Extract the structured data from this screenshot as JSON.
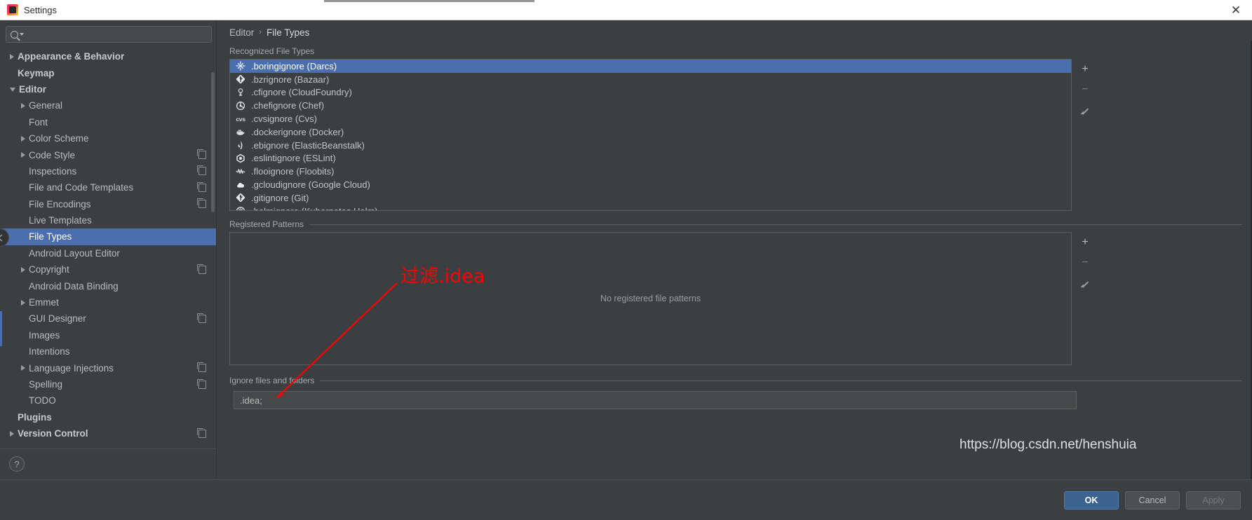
{
  "window": {
    "title": "Settings",
    "app_icon": "intellij-idea-icon",
    "close_label": "✕"
  },
  "search": {
    "placeholder": "",
    "value": "",
    "icon": "search-icon",
    "caret_icon": "chevron-down-icon"
  },
  "sidebar": {
    "items": [
      {
        "label": "Appearance & Behavior",
        "indent": 0,
        "arrow": "right",
        "bold": true,
        "selected": false,
        "copy": false
      },
      {
        "label": "Keymap",
        "indent": 0,
        "arrow": "none",
        "bold": true,
        "selected": false,
        "copy": false
      },
      {
        "label": "Editor",
        "indent": 0,
        "arrow": "down",
        "bold": true,
        "selected": false,
        "copy": false
      },
      {
        "label": "General",
        "indent": 1,
        "arrow": "right",
        "bold": false,
        "selected": false,
        "copy": false
      },
      {
        "label": "Font",
        "indent": 1,
        "arrow": "none",
        "bold": false,
        "selected": false,
        "copy": false
      },
      {
        "label": "Color Scheme",
        "indent": 1,
        "arrow": "right",
        "bold": false,
        "selected": false,
        "copy": false
      },
      {
        "label": "Code Style",
        "indent": 1,
        "arrow": "right",
        "bold": false,
        "selected": false,
        "copy": true
      },
      {
        "label": "Inspections",
        "indent": 1,
        "arrow": "none",
        "bold": false,
        "selected": false,
        "copy": true
      },
      {
        "label": "File and Code Templates",
        "indent": 1,
        "arrow": "none",
        "bold": false,
        "selected": false,
        "copy": true
      },
      {
        "label": "File Encodings",
        "indent": 1,
        "arrow": "none",
        "bold": false,
        "selected": false,
        "copy": true
      },
      {
        "label": "Live Templates",
        "indent": 1,
        "arrow": "none",
        "bold": false,
        "selected": false,
        "copy": false
      },
      {
        "label": "File Types",
        "indent": 1,
        "arrow": "none",
        "bold": false,
        "selected": true,
        "copy": false
      },
      {
        "label": "Android Layout Editor",
        "indent": 1,
        "arrow": "none",
        "bold": false,
        "selected": false,
        "copy": false
      },
      {
        "label": "Copyright",
        "indent": 1,
        "arrow": "right",
        "bold": false,
        "selected": false,
        "copy": true
      },
      {
        "label": "Android Data Binding",
        "indent": 1,
        "arrow": "none",
        "bold": false,
        "selected": false,
        "copy": false
      },
      {
        "label": "Emmet",
        "indent": 1,
        "arrow": "right",
        "bold": false,
        "selected": false,
        "copy": false
      },
      {
        "label": "GUI Designer",
        "indent": 1,
        "arrow": "none",
        "bold": false,
        "selected": false,
        "copy": true
      },
      {
        "label": "Images",
        "indent": 1,
        "arrow": "none",
        "bold": false,
        "selected": false,
        "copy": false
      },
      {
        "label": "Intentions",
        "indent": 1,
        "arrow": "none",
        "bold": false,
        "selected": false,
        "copy": false
      },
      {
        "label": "Language Injections",
        "indent": 1,
        "arrow": "right",
        "bold": false,
        "selected": false,
        "copy": true
      },
      {
        "label": "Spelling",
        "indent": 1,
        "arrow": "none",
        "bold": false,
        "selected": false,
        "copy": true
      },
      {
        "label": "TODO",
        "indent": 1,
        "arrow": "none",
        "bold": false,
        "selected": false,
        "copy": false
      },
      {
        "label": "Plugins",
        "indent": 0,
        "arrow": "none",
        "bold": true,
        "selected": false,
        "copy": false
      },
      {
        "label": "Version Control",
        "indent": 0,
        "arrow": "right",
        "bold": true,
        "selected": false,
        "copy": true
      }
    ],
    "help_label": "?",
    "collapse_icon": "chevron-left-icon"
  },
  "breadcrumb": {
    "parent": "Editor",
    "separator": "›",
    "current": "File Types"
  },
  "recognized": {
    "label": "Recognized File Types",
    "rows": [
      {
        "name": ".boringignore (Darcs)",
        "icon": "darcs-icon",
        "selected": true
      },
      {
        "name": ".bzrignore (Bazaar)",
        "icon": "bazaar-icon",
        "selected": false
      },
      {
        "name": ".cfignore (CloudFoundry)",
        "icon": "cloudfoundry-icon",
        "selected": false
      },
      {
        "name": ".chefignore (Chef)",
        "icon": "chef-icon",
        "selected": false
      },
      {
        "name": ".cvsignore (Cvs)",
        "icon": "cvs-icon",
        "selected": false
      },
      {
        "name": ".dockerignore (Docker)",
        "icon": "docker-icon",
        "selected": false
      },
      {
        "name": ".ebignore (ElasticBeanstalk)",
        "icon": "elasticbeanstalk-icon",
        "selected": false
      },
      {
        "name": ".eslintignore (ESLint)",
        "icon": "eslint-icon",
        "selected": false
      },
      {
        "name": ".flooignore (Floobits)",
        "icon": "floobits-icon",
        "selected": false
      },
      {
        "name": ".gcloudignore (Google Cloud)",
        "icon": "google-cloud-icon",
        "selected": false
      },
      {
        "name": ".gitignore (Git)",
        "icon": "git-icon",
        "selected": false
      },
      {
        "name": ".helmignore (Kubernetes Helm)",
        "icon": "helm-icon",
        "selected": false
      }
    ],
    "toolbar": {
      "add_label": "+",
      "remove_label": "−",
      "edit_icon": "pencil-icon"
    }
  },
  "registered": {
    "label": "Registered Patterns",
    "empty_text": "No registered file patterns",
    "toolbar": {
      "add_label": "+",
      "remove_label": "−",
      "edit_icon": "pencil-icon"
    }
  },
  "ignore": {
    "label": "Ignore files and folders",
    "value": ".idea;",
    "placeholder": ""
  },
  "footer": {
    "ok": "OK",
    "cancel": "Cancel",
    "apply": "Apply"
  },
  "annotations": {
    "note_text": "过滤.idea",
    "note_color": "#ff0000",
    "watermark": "https://blog.csdn.net/henshuia"
  },
  "colors": {
    "accent": "#4b6eaf",
    "panel_bg": "#3c3f41",
    "field_bg": "#45494a",
    "text": "#bbbbbb",
    "titlebar_bg": "#ffffff",
    "annotation": "#ff0000"
  }
}
